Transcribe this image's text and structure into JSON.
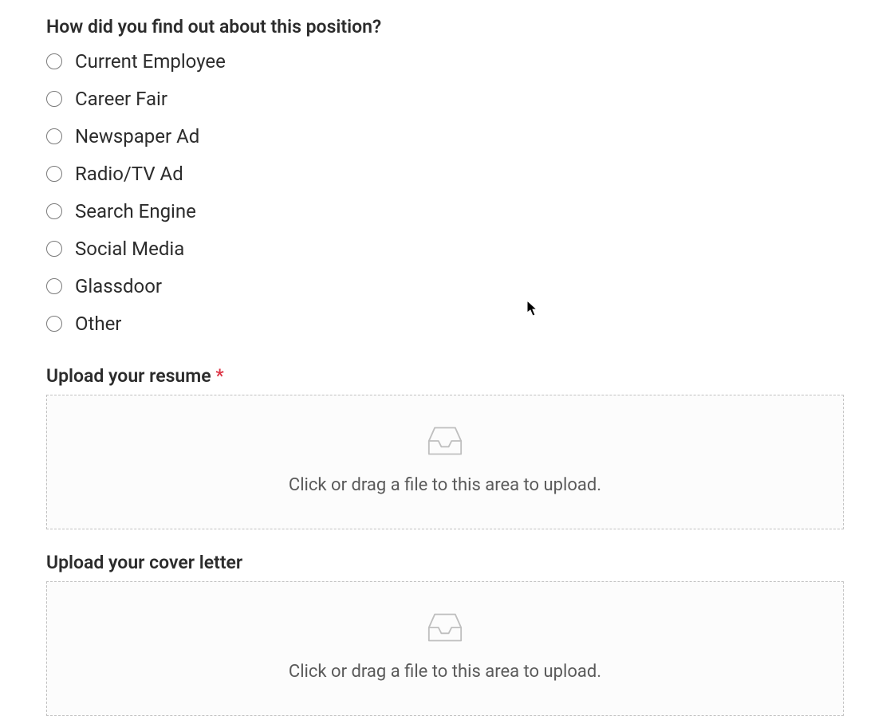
{
  "referral": {
    "question": "How did you find out about this position?",
    "options": [
      "Current Employee",
      "Career Fair",
      "Newspaper Ad",
      "Radio/TV Ad",
      "Search Engine",
      "Social Media",
      "Glassdoor",
      "Other"
    ]
  },
  "resume": {
    "label": "Upload your resume ",
    "required_mark": "*",
    "dropzone_text": "Click or drag a file to this area to upload."
  },
  "cover_letter": {
    "label": "Upload your cover letter",
    "dropzone_text": "Click or drag a file to this area to upload."
  }
}
